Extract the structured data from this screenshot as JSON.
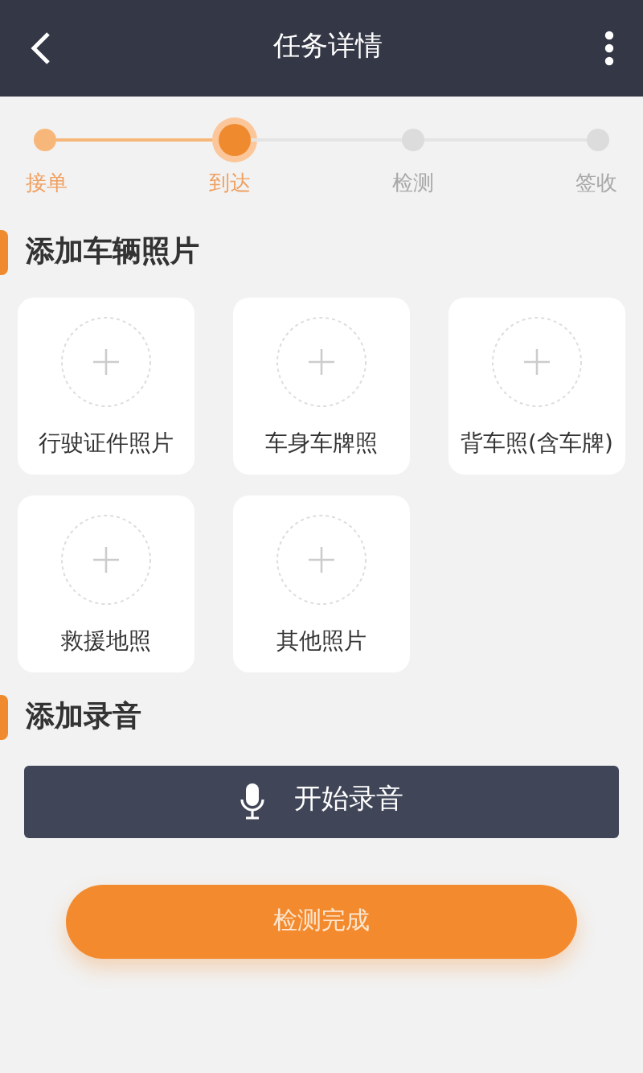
{
  "header": {
    "title": "任务详情"
  },
  "steps": [
    {
      "label": "接单",
      "kind": "done"
    },
    {
      "label": "到达",
      "kind": "current"
    },
    {
      "label": "检测",
      "kind": "pending"
    },
    {
      "label": "签收",
      "kind": "pending"
    }
  ],
  "photo_section": {
    "title": "添加车辆照片",
    "slots": [
      {
        "label": "行驶证件照片"
      },
      {
        "label": "车身车牌照"
      },
      {
        "label": "背车照(含车牌)"
      },
      {
        "label": "救援地照"
      },
      {
        "label": "其他照片"
      }
    ]
  },
  "audio_section": {
    "title": "添加录音",
    "button": "开始录音"
  },
  "submit_button": "检测完成"
}
